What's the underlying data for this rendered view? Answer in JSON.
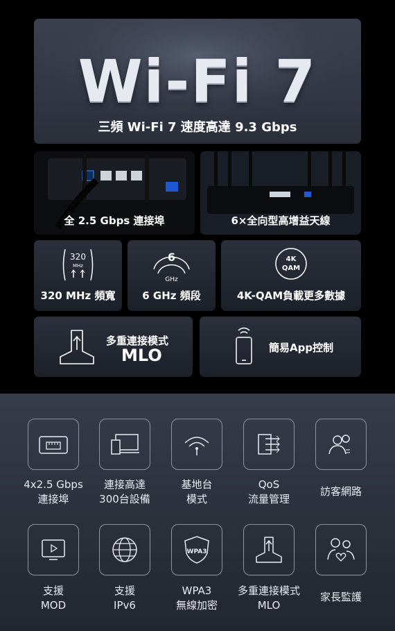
{
  "hero": {
    "title": "Wi-Fi 7",
    "subtitle": "三頻 Wi-Fi 7 速度高達 9.3 Gbps"
  },
  "photos": {
    "left_caption": "全 2.5 Gbps 連接埠",
    "right_caption": "6×全向型高增益天線"
  },
  "features": [
    {
      "label": "320 MHz 頻寬",
      "icon": "bandwidth-320mhz-icon",
      "icon_text": "320",
      "icon_subtext": "MHz"
    },
    {
      "label": "6 GHz 頻段",
      "icon": "6ghz-band-icon",
      "icon_text": "6",
      "icon_subtext": "GHz"
    },
    {
      "label": "4K-QAM負載更多數據",
      "icon": "4k-qam-icon",
      "icon_text": "4K",
      "icon_subtext": "QAM"
    }
  ],
  "mlo_card": {
    "line1": "多重連接模式",
    "line2": "MLO"
  },
  "app_card": {
    "label": "簡易App控制"
  },
  "icons_row1": [
    {
      "name": "ethernet-port-icon",
      "line1": "4x2.5 Gbps",
      "line2": "連接埠"
    },
    {
      "name": "devices-icon",
      "line1": "連接高達",
      "line2": "300台設備"
    },
    {
      "name": "access-point-icon",
      "line1": "基地台",
      "line2": "模式"
    },
    {
      "name": "qos-icon",
      "line1": "QoS",
      "line2": "流量管理"
    },
    {
      "name": "guest-network-icon",
      "line1": "訪客網路",
      "line2": ""
    }
  ],
  "icons_row2": [
    {
      "name": "mod-tv-icon",
      "line1": "支援",
      "line2": "MOD"
    },
    {
      "name": "ipv6-globe-icon",
      "line1": "支援",
      "line2": "IPv6"
    },
    {
      "name": "wpa3-shield-icon",
      "line1": "WPA3",
      "line2": "無線加密",
      "icon_text": "WPA3"
    },
    {
      "name": "mlo-icon",
      "line1": "多重連接模式",
      "line2": "MLO"
    },
    {
      "name": "parental-control-icon",
      "line1": "家長監護",
      "line2": ""
    }
  ]
}
